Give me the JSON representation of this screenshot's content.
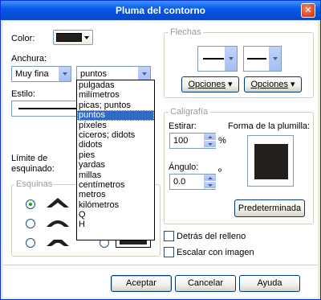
{
  "window": {
    "title": "Pluma del contorno"
  },
  "color": {
    "label": "Color:"
  },
  "width": {
    "label": "Anchura:",
    "value": "Muy fina",
    "unit": "puntos"
  },
  "style": {
    "label": "Estilo:"
  },
  "units_list": {
    "items": [
      "pulgadas",
      "milímetros",
      "picas; puntos",
      "puntos",
      "píxeles",
      "ciceros; didots",
      "didots",
      "pies",
      "yardas",
      "millas",
      "centímetros",
      "metros",
      "kilómetros",
      "Q",
      "H"
    ],
    "selected_index": 3
  },
  "miter": {
    "label": "Límite de esquinado:"
  },
  "corners": {
    "title": "Esquinas"
  },
  "arrows": {
    "title": "Flechas",
    "options_left": "Opciones",
    "options_right": "Opciones"
  },
  "calligraphy": {
    "title": "Caligrafía",
    "stretch_label": "Estirar:",
    "stretch_value": "100",
    "stretch_unit": "%",
    "angle_label": "Ángulo:",
    "angle_value": "0.0",
    "angle_unit": "º",
    "nib_label": "Forma de la plumilla:",
    "default_button": "Predeterminada"
  },
  "options": {
    "behind_fill": "Detrás del relleno",
    "scale_with_image": "Escalar con imagen"
  },
  "buttons": {
    "accept": "Aceptar",
    "cancel": "Cancelar",
    "help": "Ayuda"
  },
  "colors": {
    "title_bar": "#0a5ae8",
    "selection": "#316ac5",
    "nib": "#231f1c"
  }
}
